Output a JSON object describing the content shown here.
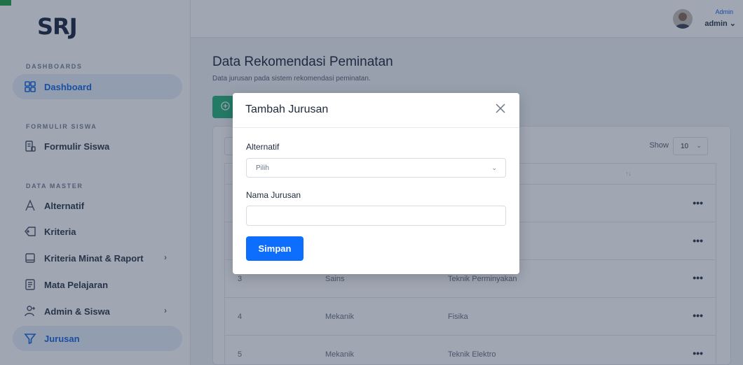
{
  "app": {
    "logo_text": "SRJ"
  },
  "sidebar": {
    "sections": [
      {
        "label": "DASHBOARDS"
      },
      {
        "label": "FORMULIR SISWA"
      },
      {
        "label": "DATA MASTER"
      }
    ],
    "items": [
      {
        "label": "Dashboard",
        "icon": "dashboard-grid-icon",
        "active": true
      },
      {
        "label": "Formulir Siswa",
        "icon": "form-icon"
      },
      {
        "label": "Alternatif",
        "icon": "letter-a-icon"
      },
      {
        "label": "Kriteria",
        "icon": "tag-icon"
      },
      {
        "label": "Kriteria Minat & Raport",
        "icon": "tablet-icon",
        "chevron": "›"
      },
      {
        "label": "Mata Pelajaran",
        "icon": "document-icon"
      },
      {
        "label": "Admin & Siswa",
        "icon": "user-plus-icon",
        "chevron": "›"
      },
      {
        "label": "Jurusan",
        "icon": "filter-icon",
        "active": true
      }
    ]
  },
  "header": {
    "user_role": "Admin",
    "user_name": "admin ⌄"
  },
  "page": {
    "title": "Data Rekomendasi Peminatan",
    "subtitle": "Data jurusan pada sistem rekomendasi peminatan.",
    "add_icon": "plus-circle-icon"
  },
  "table_controls": {
    "show_label": "Show",
    "page_size": "10"
  },
  "table": {
    "sort_glyph": "↑↓",
    "more_glyph": "•••",
    "rows": [
      {
        "no": "3",
        "alternatif": "Sains",
        "jurusan": "Teknik Perminyakan"
      },
      {
        "no": "4",
        "alternatif": "Mekanik",
        "jurusan": "Fisika"
      },
      {
        "no": "5",
        "alternatif": "Mekanik",
        "jurusan": "Teknik Elektro"
      }
    ]
  },
  "modal": {
    "title": "Tambah Jurusan",
    "alternatif_label": "Alternatif",
    "alternatif_selected": "Pilih",
    "nama_label": "Nama Jurusan",
    "nama_value": "",
    "save_label": "Simpan"
  },
  "colors": {
    "primary": "#0d6efd",
    "success": "#28b47a",
    "sidebar_active": "#1769e0",
    "backdrop": "rgba(28,44,72,0.42)"
  }
}
